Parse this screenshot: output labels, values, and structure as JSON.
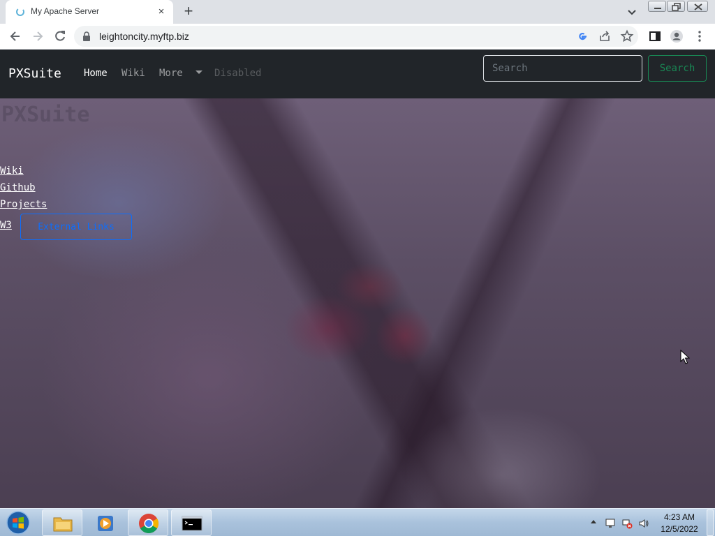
{
  "browser": {
    "tab_title": "My Apache Server",
    "tab_close_icon": "×",
    "new_tab_icon": "+",
    "url": "leightoncity.myftp.biz"
  },
  "navbar": {
    "brand": "PXSuite",
    "links": [
      "Home",
      "Wiki",
      "More",
      "Disabled"
    ],
    "search_placeholder": "Search",
    "search_button": "Search",
    "colors": {
      "background": "#212529",
      "search_button": "#198754"
    }
  },
  "hero": {
    "title": "PXSuite",
    "subtitle": ""
  },
  "page_links": [
    "Wiki",
    "Github",
    "Projects",
    "W3"
  ],
  "external_links_button": "External Links",
  "taskbar": {
    "apps": [
      "windows-explorer",
      "media-player",
      "google-chrome",
      "command-prompt"
    ],
    "clock_time": "4:23 AM",
    "clock_date": "12/5/2022"
  }
}
